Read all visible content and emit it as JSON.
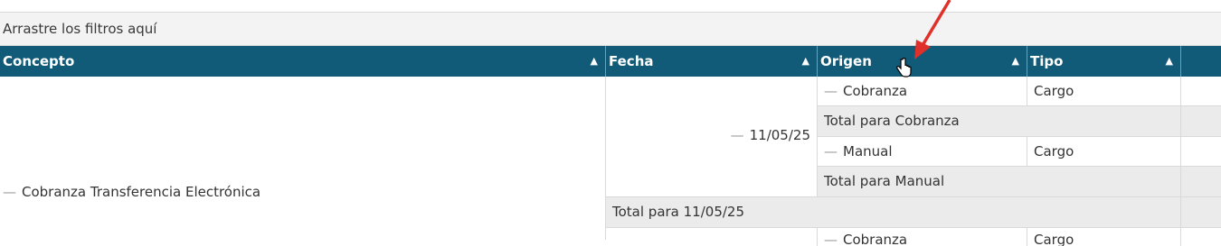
{
  "filter_bar": {
    "placeholder": "Arrastre los filtros aquí"
  },
  "columns": [
    {
      "label": "Concepto",
      "sort_icon": "▲"
    },
    {
      "label": "Fecha",
      "sort_icon": "▲"
    },
    {
      "label": "Origen",
      "sort_icon": "▲"
    },
    {
      "label": "Tipo",
      "sort_icon": "▲"
    }
  ],
  "rows": {
    "concepto": "Cobranza Transferencia Electrónica",
    "fecha": "11/05/25",
    "origen_1": "Cobranza",
    "tipo_1": "Cargo",
    "total_origen_1": "Total para Cobranza",
    "origen_2": "Manual",
    "tipo_2": "Cargo",
    "total_origen_2": "Total para Manual",
    "total_fecha": "Total para 11/05/25",
    "origen_3": "Cobranza",
    "tipo_3": "Cargo"
  },
  "glyphs": {
    "collapse": "—"
  },
  "colors": {
    "header_bg": "#115a78",
    "annotation_arrow": "#e0302a"
  }
}
